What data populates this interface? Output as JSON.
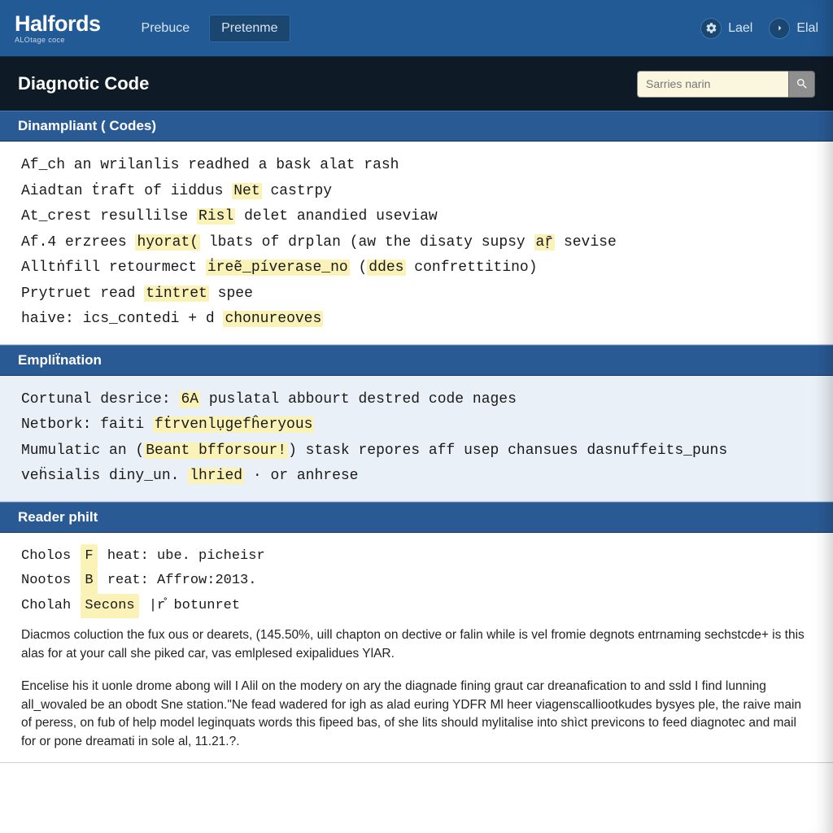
{
  "header": {
    "logo_main": "Halfords",
    "logo_sub": "ALOtage coce",
    "nav": {
      "item1": "Prebuce",
      "item2": "Pretenme"
    },
    "right": {
      "label1": "Lael",
      "label2": "Elal"
    }
  },
  "subheader": {
    "title": "Diagnotic Code",
    "search_placeholder": "Sarries narin"
  },
  "sections": {
    "codes": {
      "title": "Dinampliant ( Codes)",
      "lines": [
        {
          "pre": "Af_ch an wrilanlis readhed a bask alat rash"
        },
        {
          "pre": "Aiadtan ṫraft of iiddus ",
          "hl": "Net",
          "post": " castrpy"
        },
        {
          "pre": "At_crest resullilse ",
          "hl": "Risl",
          "post": " delet anandied useviaw"
        },
        {
          "pre": "Af.4 erzrees ",
          "hl": "hyorat(",
          "mid1": " lbats of drplan (aw the disaty supsy ",
          "hl2": "aṝ",
          "post": " sevise"
        },
        {
          "pre": "Alltṅfill retourmect ",
          "hl": "i̇reẽ_píverase_no",
          "mid1": " (",
          "hl2": "ddes",
          "post": " confrettitino)"
        },
        {
          "pre": "Prytruet read ",
          "hl": "tintret",
          "post": " spee"
        },
        {
          "pre": "haive: ics_contedi + d ",
          "hl": "chonureoves"
        }
      ]
    },
    "explanation": {
      "title": "Empliẗnation",
      "lines": [
        {
          "pre": "Cortunal desrice: ",
          "hl": "6A",
          "post": " puslatal abbourt destred code nages"
        },
        {
          "pre": "Netbork: faiti ",
          "hl": "fṫrvenlụgefĥeryous"
        },
        {
          "pre": "Mumulatic an (",
          "hl": "Beant  bfforsour!",
          "post": ") stask repores aff usep chansues dasnuffeits_puns"
        },
        {
          "pre": "veḧsialis diny_un. ",
          "hl": "lhried",
          "post": "  · or anhrese"
        }
      ]
    },
    "reader": {
      "title": "Reader philt",
      "kv": [
        {
          "label": "Cholos ",
          "kbd": "F",
          "mid": "  heat:   ube. picheisr"
        },
        {
          "label": "Nootos ",
          "kbd": "B",
          "mid": "  reat:   Affrow:2013."
        },
        {
          "label": "Cholah ",
          "kbd": "Secons",
          "mid": "  |r̊  botunret"
        }
      ],
      "para1": "Diacmos coluction the fux ous or dearets, (145.50%, uill chapton on dective or falin while is vel fromie degnots entrnaming sechstcde+ is this alas for at your call she piked car, vas emlplesed exipalidues YlAR.",
      "para2": "Encelise his it uonle drome abong will I Alil on the modery on ary the diagnade fining graut car dreanafication to and ssld I find lunning all_wovaled be an obodt Sne station.\"Ne fead wadered for igh as alad euring YDFR Ml heer viagenscalliootkudes bysyes ple, the raive main of peress, on fub of help model leginquats words this fipeed bas, of she lits should mylitalise into shìct previcons to feed diagnotec and mail for or pone dreamati in sole al, 11.21.?."
    }
  }
}
